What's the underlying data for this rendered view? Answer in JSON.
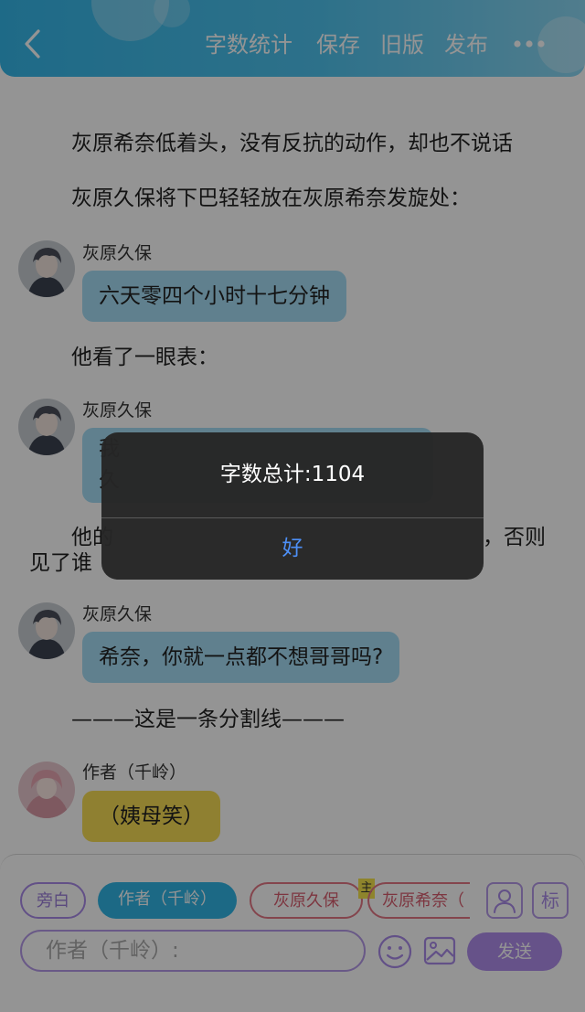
{
  "header": {
    "actions": {
      "word_count": "字数统计",
      "save": "保存",
      "old_version": "旧版",
      "publish": "发布"
    },
    "icons": [
      "chevron-left-icon",
      "more-horizontal-icon"
    ],
    "bg_color": "#35b7e9"
  },
  "chat": {
    "narration_1": "灰原希奈低着头，没有反抗的动作，却也不说话",
    "narration_2": "灰原久保将下巴轻轻放在灰原希奈发旋处：",
    "msg1": {
      "speaker": "灰原久保",
      "text": "六天零四个小时十七分钟"
    },
    "narration_3": "他看了一眼表：",
    "msg2": {
      "speaker": "灰原久保",
      "text_line1": "我",
      "text_line2": "久"
    },
    "narration_4_left": "他的",
    "narration_4_right": "，否则",
    "narration_4_line2": "见了谁",
    "msg3": {
      "speaker": "灰原久保",
      "text": "希奈，你就一点都不想哥哥吗?"
    },
    "divider_text": "———这是一条分割线———",
    "msg4": {
      "speaker": "作者（千岭）",
      "text": "（姨母笑）"
    },
    "bubble_color": "#a5ddf5",
    "author_bubble_color": "#f7dc55"
  },
  "input_panel": {
    "roles": {
      "narration": "旁白",
      "author": "作者（千岭）",
      "haibara_kubo": "灰原久保",
      "haibara_kina": "灰原希奈（"
    },
    "main_badge": "主",
    "label_button": "标",
    "input_placeholder": "作者（千岭）:",
    "send": "发送",
    "accent_color": "#b08ded"
  },
  "alert": {
    "message": "字数总计:1104",
    "ok": "好",
    "ok_color": "#4d8ff6"
  }
}
